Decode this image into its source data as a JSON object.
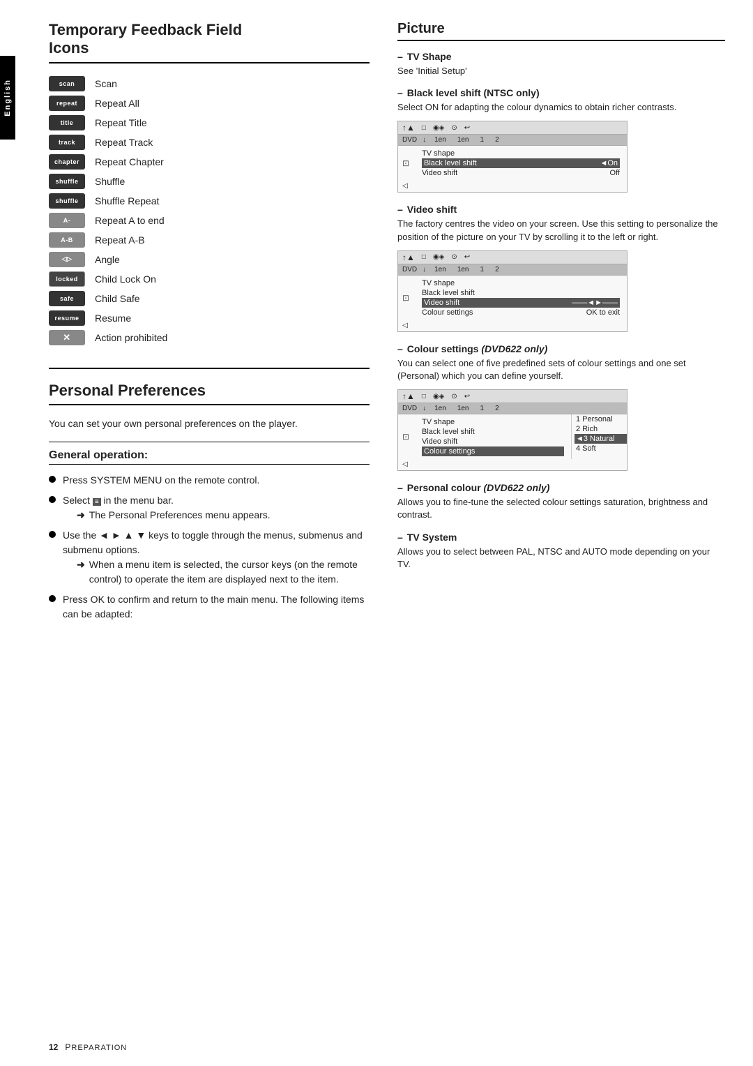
{
  "sidebar": {
    "label": "English"
  },
  "left": {
    "section_title_line1": "Temporary Feedback Field",
    "section_title_line2": "Icons",
    "icons": [
      {
        "badge": "scan",
        "label": "Scan"
      },
      {
        "badge": "repeat",
        "label": "Repeat All"
      },
      {
        "badge": "title",
        "label": "Repeat Title"
      },
      {
        "badge": "track",
        "label": "Repeat Track"
      },
      {
        "badge": "chapter",
        "label": "Repeat Chapter"
      },
      {
        "badge": "shuffle",
        "label": "Shuffle"
      },
      {
        "badge": "shuffle",
        "label": "Shuffle Repeat"
      },
      {
        "badge": "A-",
        "label": "Repeat A to end"
      },
      {
        "badge": "A-B",
        "label": "Repeat A-B"
      },
      {
        "badge": "◁▷",
        "label": "Angle"
      },
      {
        "badge": "locked",
        "label": "Child Lock On"
      },
      {
        "badge": "safe",
        "label": "Child Safe"
      },
      {
        "badge": "resume",
        "label": "Resume"
      },
      {
        "badge": "✕",
        "label": "Action prohibited"
      }
    ],
    "personal_prefs": {
      "section_title": "Personal Preferences",
      "intro": "You can set your own personal preferences on the player.",
      "sub_heading": "General operation:",
      "bullets": [
        {
          "text": "Press SYSTEM MENU on the remote control.",
          "sub": null
        },
        {
          "text": "Select ",
          "icon": "menu-icon",
          "text2": " in the menu bar.",
          "sub": "The Personal Preferences menu appears."
        },
        {
          "text": "Use the ◄ ► ▲ ▼ keys to toggle through the menus, submenus and submenu options.",
          "sub": "When a menu item is selected, the cursor keys (on the remote control) to operate the item are displayed next to the item."
        },
        {
          "text": "Press OK to confirm and return to the main menu. The following items can be adapted:",
          "sub": null
        }
      ]
    }
  },
  "right": {
    "section_title": "Picture",
    "items": [
      {
        "heading": "TV Shape",
        "text": "See 'Initial Setup'",
        "has_menu": false
      },
      {
        "heading": "Black level shift (NTSC only)",
        "text": "Select ON for adapting the colour dynamics to obtain richer contrasts.",
        "has_menu": true,
        "menu": {
          "header_items": [
            "↑▲",
            "□",
            "◉◈",
            "⊙",
            "↩"
          ],
          "sub_header": [
            "DVD",
            "1en",
            "1en",
            "1",
            "2"
          ],
          "rows": [
            {
              "icon": "⊡",
              "label": "TV shape",
              "value": ""
            },
            {
              "icon": "",
              "label": "Black level shift",
              "value": "◄On",
              "highlighted": true
            },
            {
              "icon": "◁",
              "label": "Video shift",
              "value": "Off"
            }
          ],
          "options": []
        }
      },
      {
        "heading": "Video shift",
        "text": "The factory centres the video on your screen. Use this setting to personalize the position of the picture on your TV by scrolling it to the left or right.",
        "has_menu": true,
        "menu": {
          "header_items": [
            "↑▲",
            "□",
            "◉◈",
            "⊙",
            "↩"
          ],
          "sub_header": [
            "DVD",
            "1en",
            "1en",
            "1",
            "2"
          ],
          "rows": [
            {
              "icon": "⊡",
              "label": "TV shape",
              "value": ""
            },
            {
              "icon": "",
              "label": "Black level shift",
              "value": ""
            },
            {
              "icon": "◁",
              "label": "Video shift",
              "value": "◄►",
              "highlighted": true
            },
            {
              "icon": "",
              "label": "Colour settings",
              "value": "OK to exit"
            }
          ],
          "options": []
        }
      },
      {
        "heading": "Colour settings (DVD622 only)",
        "text": "You can select one of five predefined sets of colour settings and one set (Personal) which you can define yourself.",
        "has_menu": true,
        "menu": {
          "header_items": [
            "↑▲",
            "□",
            "◉◈",
            "⊙",
            "↩"
          ],
          "sub_header": [
            "DVD",
            "1en",
            "1en",
            "1",
            "2"
          ],
          "rows": [
            {
              "icon": "⊡",
              "label": "TV shape",
              "value": ""
            },
            {
              "icon": "",
              "label": "Black level shift",
              "value": ""
            },
            {
              "icon": "◁",
              "label": "Video shift",
              "value": ""
            },
            {
              "icon": "",
              "label": "Colour settings",
              "value": "",
              "highlighted": true
            }
          ],
          "options": [
            "1 Personal",
            "2 Rich",
            "◄3 Natural",
            "4 Soft"
          ]
        }
      },
      {
        "heading": "Personal colour (DVD622 only)",
        "text": "Allows you to fine-tune the selected colour settings saturation, brightness and contrast.",
        "has_menu": false
      },
      {
        "heading": "TV System",
        "text": "Allows you to select between PAL, NTSC and AUTO mode depending on your TV.",
        "has_menu": false
      }
    ]
  },
  "footer": {
    "page_number": "12",
    "label": "Preparation"
  }
}
